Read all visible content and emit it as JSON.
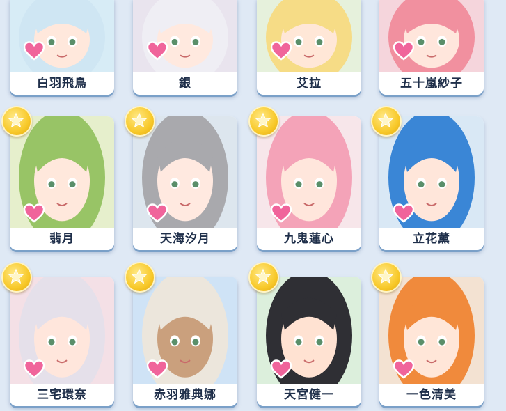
{
  "cards": [
    {
      "name": "白羽飛鳥",
      "starred": false,
      "bg": "#d7ecf6",
      "hair": "#cfe6f3",
      "skin": "#ffe8dc"
    },
    {
      "name": "銀",
      "starred": false,
      "bg": "#e9e4ee",
      "hair": "#efeef4",
      "skin": "#ffe9df"
    },
    {
      "name": "艾拉",
      "starred": false,
      "bg": "#e6f1dc",
      "hair": "#f6dc86",
      "skin": "#ffe7d7"
    },
    {
      "name": "五十嵐紗子",
      "starred": false,
      "bg": "#f5d5dc",
      "hair": "#f1909f",
      "skin": "#ffe6dc"
    },
    {
      "name": "翡月",
      "starred": true,
      "bg": "#e6efcc",
      "hair": "#98c466",
      "skin": "#ffe8dc"
    },
    {
      "name": "天海汐月",
      "starred": true,
      "bg": "#dde6ee",
      "hair": "#a9a9ad",
      "skin": "#ffe9e0"
    },
    {
      "name": "九鬼蓮心",
      "starred": true,
      "bg": "#f7e6ea",
      "hair": "#f4a3b8",
      "skin": "#ffe6dc"
    },
    {
      "name": "立花薰",
      "starred": true,
      "bg": "#d9e8f5",
      "hair": "#3a86d6",
      "skin": "#ffe6da"
    },
    {
      "name": "三宅環奈",
      "starred": true,
      "bg": "#f4e0e6",
      "hair": "#e5e0ea",
      "skin": "#ffe6dc"
    },
    {
      "name": "赤羽雅典娜",
      "starred": true,
      "bg": "#cfe3f6",
      "hair": "#ece6dc",
      "skin": "#caa07d"
    },
    {
      "name": "天宮健一",
      "starred": true,
      "bg": "#dcefdc",
      "hair": "#2f2f34",
      "skin": "#ffe2d2"
    },
    {
      "name": "一色清美",
      "starred": true,
      "bg": "#f3e2d2",
      "hair": "#f08a3c",
      "skin": "#ffe6d8"
    }
  ],
  "icons": {
    "favorite": "heart-icon",
    "star": "star-icon"
  },
  "colors": {
    "heart": "#f0649b",
    "star": "#f8c92a",
    "name_text": "#1f2f4a"
  }
}
